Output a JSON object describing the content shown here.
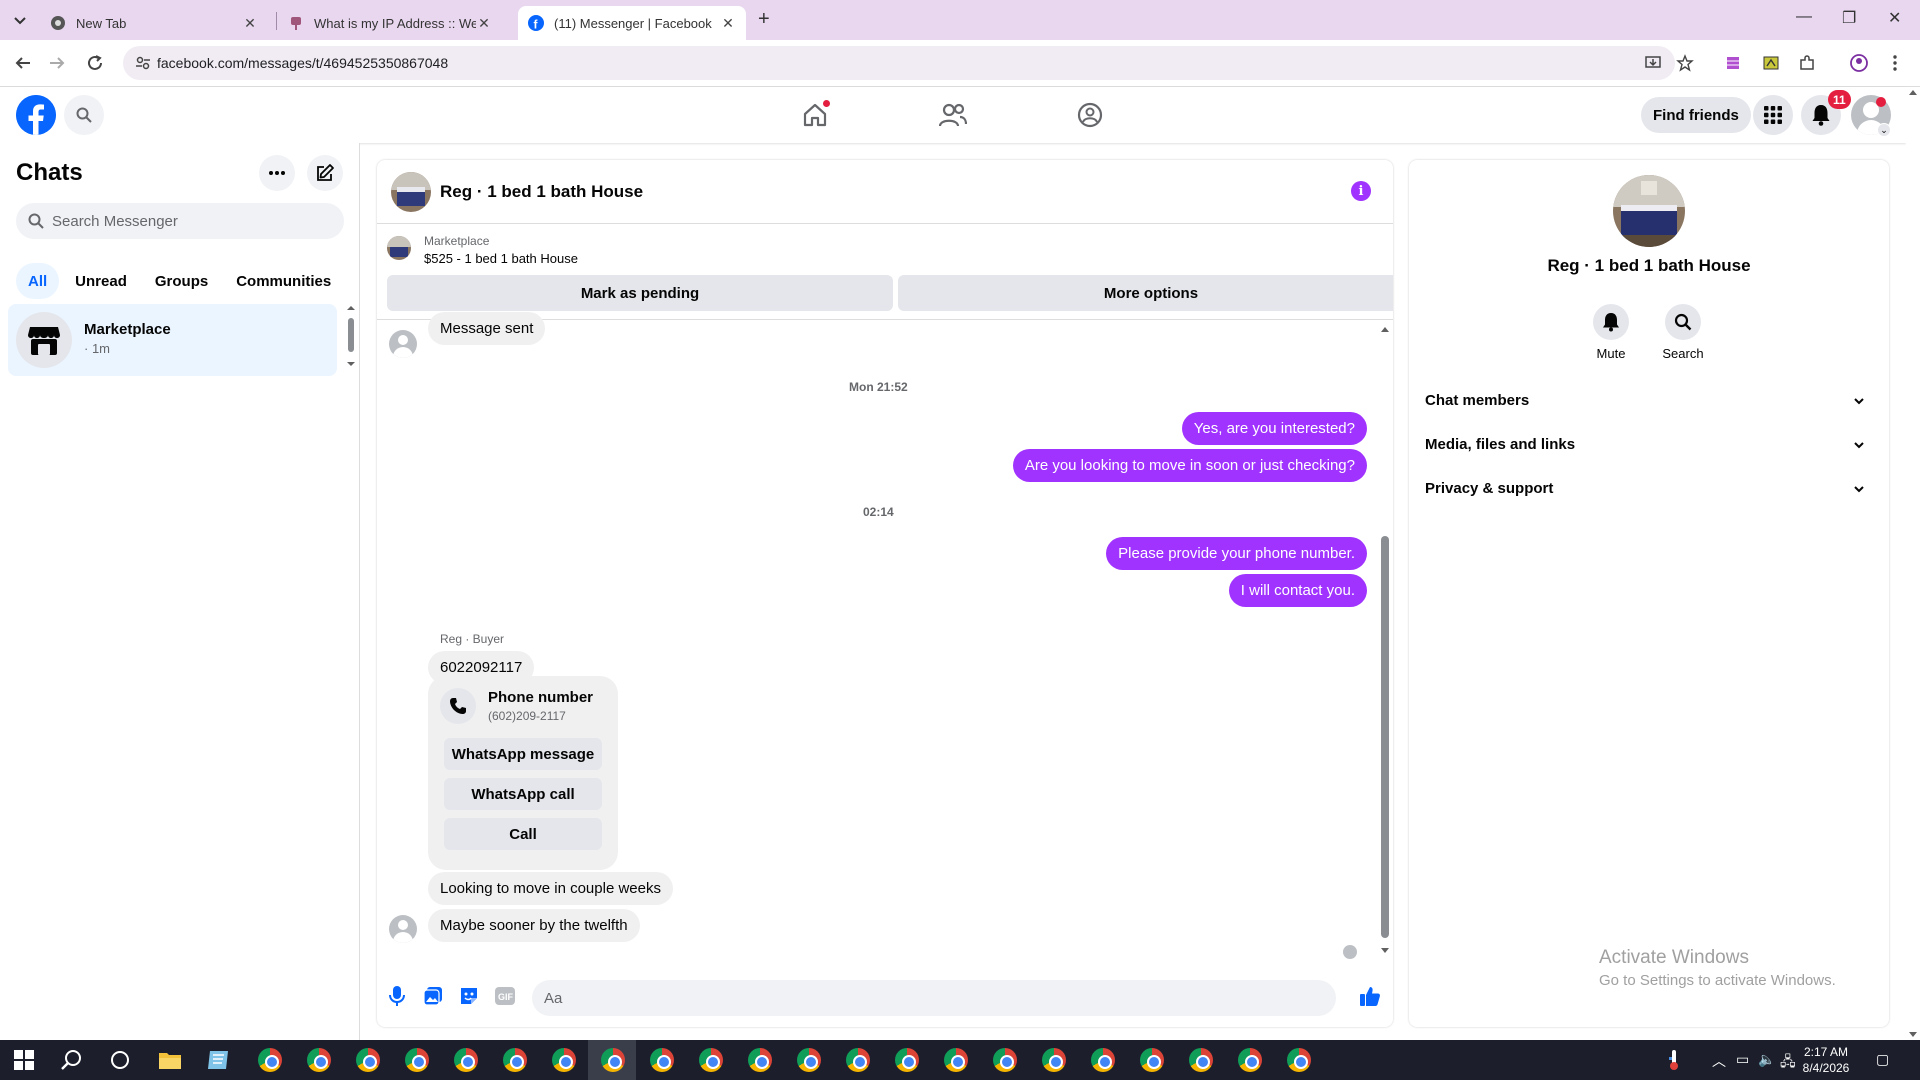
{
  "browser": {
    "tabs": [
      {
        "title": "New Tab",
        "icon": "chrome-icon",
        "active": false
      },
      {
        "title": "What is my IP Address :: WebBr",
        "icon": "webbrowser-icon",
        "active": false
      },
      {
        "title": "(11) Messenger | Facebook",
        "icon": "facebook-icon",
        "active": true
      }
    ],
    "url": "facebook.com/messages/t/4694525350867048"
  },
  "header": {
    "find_friends": "Find friends",
    "notification_count": "11"
  },
  "sidebar": {
    "title": "Chats",
    "search_placeholder": "Search Messenger",
    "filters": [
      "All",
      "Unread",
      "Groups",
      "Communities"
    ],
    "chats": [
      {
        "name": "Marketplace",
        "time": "· 1m"
      }
    ]
  },
  "conversation": {
    "name": "Reg · 1 bed 1 bath House",
    "marketplace": {
      "label": "Marketplace",
      "listing": "$525 - 1 bed 1 bath House",
      "actions": [
        "Mark as pending",
        "More options"
      ]
    },
    "messages": {
      "m1": "Message sent",
      "ts1": "Mon 21:52",
      "m2": "Yes, are you interested?",
      "m3": "Are you looking to move in soon or just checking?",
      "ts2": "02:14",
      "m4": "Please provide your phone number.",
      "m5": "I will contact you.",
      "sender": "Reg · Buyer",
      "m6": "6022092117",
      "phone_card": {
        "title": "Phone number",
        "number": "(602)209-2117",
        "buttons": [
          "WhatsApp message",
          "WhatsApp call",
          "Call"
        ]
      },
      "m7": "Looking to move in couple weeks",
      "m8": "Maybe sooner by the twelfth"
    },
    "composer_placeholder": "Aa"
  },
  "info_panel": {
    "name": "Reg · 1 bed 1 bath House",
    "actions": [
      "Mute",
      "Search"
    ],
    "sections": [
      "Chat members",
      "Media, files and links",
      "Privacy & support"
    ]
  },
  "watermark": {
    "line1": "Activate Windows",
    "line2": "Go to Settings to activate Windows."
  },
  "taskbar": {
    "time": "2:17 AM",
    "date": "8/4/2026"
  },
  "colors": {
    "facebook_blue": "#0866ff",
    "message_purple": "#a033ff",
    "notification_red": "#e41e3f"
  }
}
